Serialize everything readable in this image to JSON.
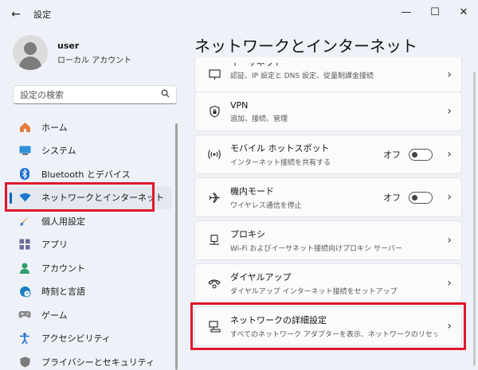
{
  "window": {
    "title": "設定",
    "back_icon": "←",
    "minimize_icon": "—",
    "maximize_icon": "☐",
    "close_icon": "✕"
  },
  "user": {
    "name": "user",
    "account_type": "ローカル アカウント"
  },
  "search": {
    "placeholder": "設定の検索"
  },
  "sidebar": {
    "items": [
      {
        "label": "ホーム",
        "icon": "home-icon"
      },
      {
        "label": "システム",
        "icon": "system-icon"
      },
      {
        "label": "Bluetooth とデバイス",
        "icon": "bluetooth-icon"
      },
      {
        "label": "ネットワークとインターネット",
        "icon": "wifi-icon",
        "selected": true
      },
      {
        "label": "個人用設定",
        "icon": "brush-icon"
      },
      {
        "label": "アプリ",
        "icon": "apps-icon"
      },
      {
        "label": "アカウント",
        "icon": "account-icon"
      },
      {
        "label": "時刻と言語",
        "icon": "clock-globe-icon"
      },
      {
        "label": "ゲーム",
        "icon": "gamepad-icon"
      },
      {
        "label": "アクセシビリティ",
        "icon": "accessibility-icon"
      },
      {
        "label": "プライバシーとセキュリティ",
        "icon": "shield-icon"
      }
    ]
  },
  "main": {
    "title": "ネットワークとインターネット",
    "cards": [
      {
        "title": "イーサネット",
        "desc": "認証、IP 設定と DNS 設定、従量制課金接続",
        "icon": "ethernet-icon"
      },
      {
        "title": "VPN",
        "desc": "追加、接続、管理",
        "icon": "vpn-shield-icon"
      },
      {
        "title": "モバイル ホットスポット",
        "desc": "インターネット接続を共有する",
        "icon": "hotspot-icon",
        "toggle": "オフ"
      },
      {
        "title": "機内モード",
        "desc": "ワイヤレス通信を停止",
        "icon": "airplane-icon",
        "toggle": "オフ"
      },
      {
        "title": "プロキシ",
        "desc": "Wi-Fi およびイーサネット接続向けプロキシ サーバー",
        "icon": "proxy-icon"
      },
      {
        "title": "ダイヤルアップ",
        "desc": "ダイヤルアップ インターネット接続をセットアップ",
        "icon": "dialup-icon"
      },
      {
        "title": "ネットワークの詳細設定",
        "desc": "すべてのネットワーク アダプターを表示、ネットワークのリセット",
        "icon": "network-adapter-icon"
      }
    ]
  },
  "colors": {
    "accent": "#0067c0",
    "highlight": "#e0162b",
    "background": "#eef2f8"
  }
}
